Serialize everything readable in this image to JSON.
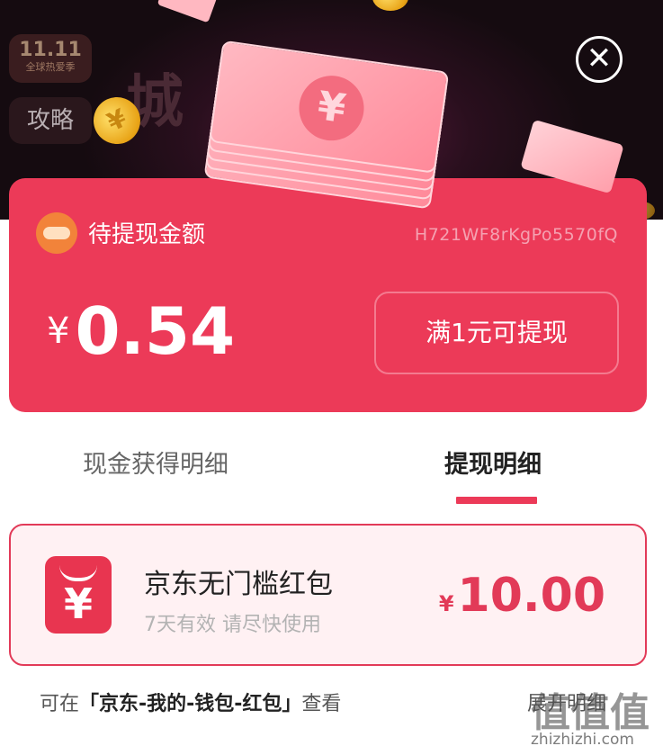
{
  "header": {
    "badge_number": "11.11",
    "badge_sub": "全球热爱季",
    "gonglue": "攻略",
    "bg_title": "城  现金",
    "close_icon": "✕"
  },
  "card": {
    "label": "待提现金额",
    "code": "H721WF8rKgPo5570fQ",
    "currency": "¥",
    "amount": "0.54",
    "withdraw_button": "满1元可提现"
  },
  "tabs": {
    "cash_detail": "现金获得明细",
    "withdraw_detail": "提现明细",
    "active": "withdraw_detail"
  },
  "coupon": {
    "title": "京东无门槛红包",
    "subtitle": "7天有效 请尽快使用",
    "currency": "¥",
    "amount": "10.00"
  },
  "note": {
    "prefix": "可在",
    "path": "「京东-我的-钱包-红包」",
    "suffix": "查看",
    "expand": "展开明细"
  },
  "watermark": {
    "main": "值值值",
    "sub": "zhizhizhi.com"
  },
  "colors": {
    "accent": "#ec3a58",
    "background_dark": "#1a0f14",
    "coupon_bg": "#fff1f3"
  },
  "icons": [
    "close-icon",
    "avatar-icon",
    "coin-icon",
    "yen-icon",
    "money-stack-icon"
  ]
}
